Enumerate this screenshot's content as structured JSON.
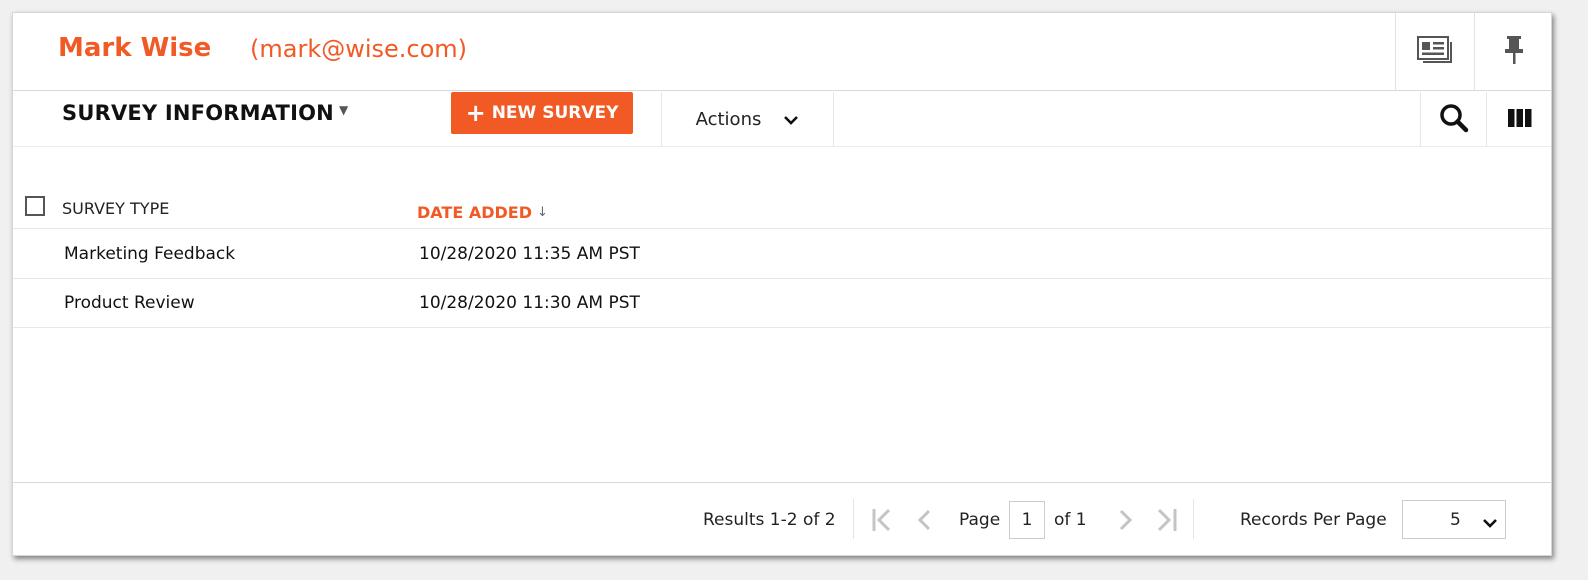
{
  "header": {
    "user_name": "Mark Wise",
    "user_email": "(mark@wise.com)",
    "icons": [
      "contact-card-icon",
      "pin-icon"
    ]
  },
  "toolbar": {
    "section_title": "SURVEY INFORMATION",
    "new_survey_label": "NEW SURVEY",
    "actions_label": "Actions",
    "icons": [
      "search-icon",
      "columns-icon"
    ]
  },
  "table": {
    "columns": [
      {
        "label": "SURVEY TYPE"
      },
      {
        "label": "DATE ADDED",
        "sorted": "descending"
      }
    ],
    "rows": [
      {
        "type": "Marketing Feedback",
        "date": "10/28/2020 11:35 AM PST"
      },
      {
        "type": "Product Review",
        "date": "10/28/2020 11:30 AM PST"
      }
    ]
  },
  "pagination": {
    "results_prefix": "Results",
    "results_range": "1-2",
    "results_of": "of",
    "results_total": "2",
    "page_label": "Page",
    "current_page": "1",
    "of_label": "of",
    "total_pages": "1",
    "records_per_page_label": "Records Per Page",
    "records_per_page": "5"
  },
  "colors": {
    "accent": "#f15a24",
    "text": "#222222",
    "border": "#d9d9d9"
  }
}
